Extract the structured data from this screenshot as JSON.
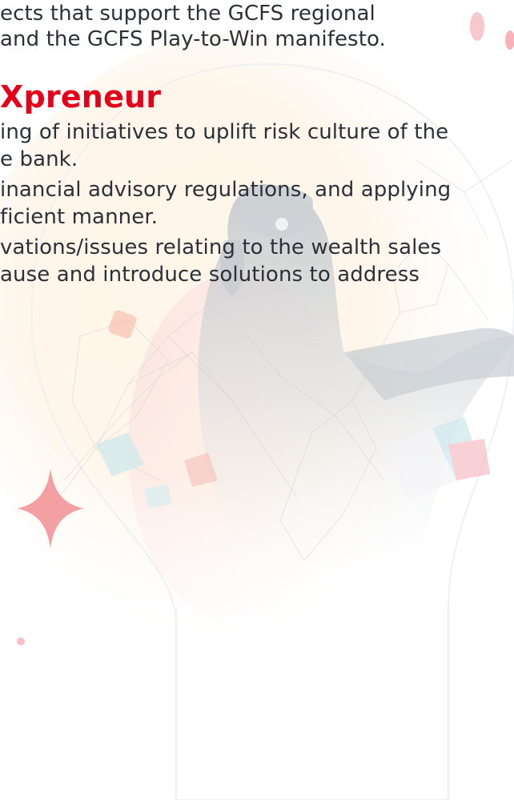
{
  "intro": {
    "lines": [
      "ects that support the GCFS regional",
      " and the GCFS Play-to-Win manifesto."
    ]
  },
  "section": {
    "heading": "Xpreneur",
    "lines": [
      "ing of initiatives to uplift risk culture of the",
      "e bank.",
      "inancial advisory regulations, and applying",
      "ficient manner.",
      "vations/issues relating to the wealth sales",
      "ause and introduce solutions to address"
    ]
  },
  "colors": {
    "accent": "#e3001b",
    "body_text": "#2c3038",
    "bulb_glow": "#fde9c9"
  },
  "illustration": {
    "icons": [
      "lightbulb-illustration",
      "vr-headset-person-illustration",
      "sparkle-star-icon",
      "network-mesh-graphic",
      "floating-cubes-graphic"
    ]
  }
}
